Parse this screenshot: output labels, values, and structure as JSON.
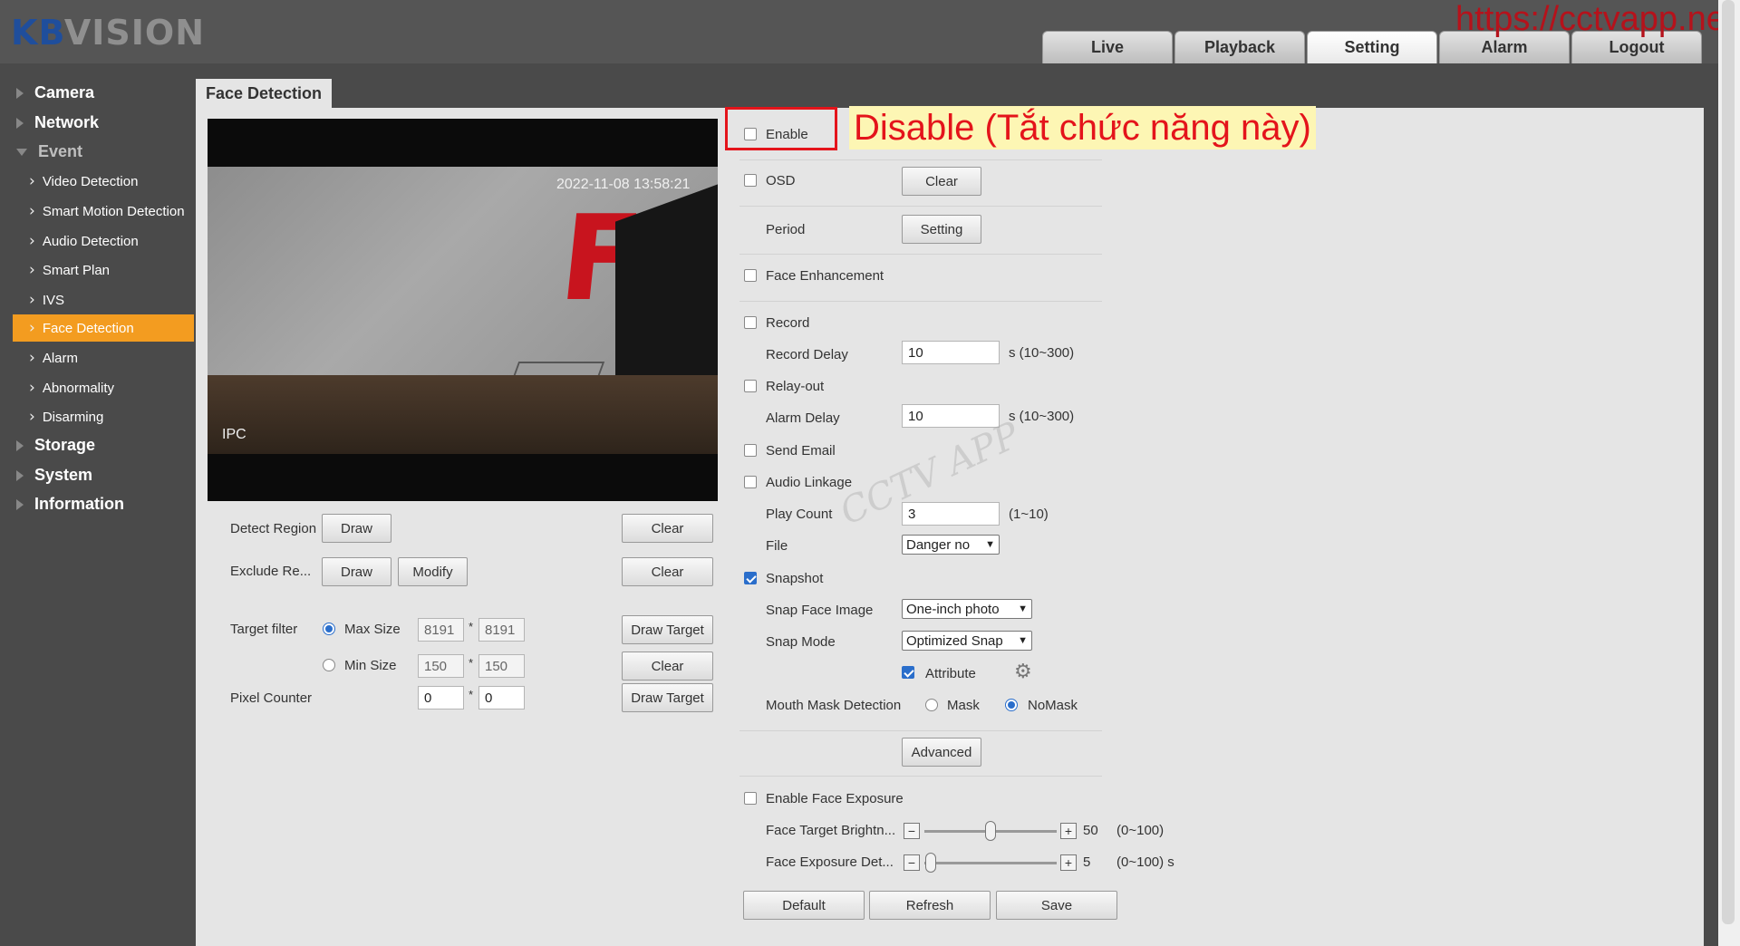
{
  "header": {
    "logo_kb": "KB",
    "logo_vision": "VISION",
    "watermark_url": "https://cctvapp.net",
    "nav": [
      "Live",
      "Playback",
      "Setting",
      "Alarm",
      "Logout"
    ]
  },
  "sidebar": {
    "camera": "Camera",
    "network": "Network",
    "event": "Event",
    "sub": [
      "Video Detection",
      "Smart Motion Detection",
      "Audio Detection",
      "Smart Plan",
      "IVS",
      "Face Detection",
      "Alarm",
      "Abnormality",
      "Disarming"
    ],
    "storage": "Storage",
    "system": "System",
    "information": "Information"
  },
  "page": {
    "tab": "Face Detection"
  },
  "video": {
    "timestamp": "2022-11-08 13:58:21",
    "channel": "IPC"
  },
  "left": {
    "detect_region": "Detect Region",
    "exclude_region": "Exclude Re...",
    "draw": "Draw",
    "modify": "Modify",
    "clear": "Clear",
    "target_filter": "Target filter",
    "max_size": "Max Size",
    "min_size": "Min Size",
    "max_w": "8191",
    "max_h": "8191",
    "min_w": "150",
    "min_h": "150",
    "pixel_counter": "Pixel Counter",
    "pc_w": "0",
    "pc_h": "0",
    "times": "*",
    "draw_target": "Draw Target"
  },
  "right": {
    "enable": "Enable",
    "osd": "OSD",
    "osd_clear": "Clear",
    "period": "Period",
    "period_setting": "Setting",
    "face_enhancement": "Face Enhancement",
    "record": "Record",
    "record_delay": "Record Delay",
    "record_delay_value": "10",
    "record_delay_range": "s (10~300)",
    "relay_out": "Relay-out",
    "alarm_delay": "Alarm Delay",
    "alarm_delay_value": "10",
    "alarm_delay_range": "s (10~300)",
    "send_email": "Send Email",
    "audio_linkage": "Audio Linkage",
    "play_count": "Play Count",
    "play_count_value": "3",
    "play_count_range": "(1~10)",
    "file": "File",
    "file_value": "Danger no",
    "snapshot": "Snapshot",
    "snap_face_image": "Snap Face Image",
    "snap_face_image_value": "One-inch photo",
    "snap_mode": "Snap Mode",
    "snap_mode_value": "Optimized Snap",
    "attribute": "Attribute",
    "mouth_mask": "Mouth Mask Detection",
    "mask": "Mask",
    "nomask": "NoMask",
    "advanced": "Advanced",
    "enable_face_exposure": "Enable Face Exposure",
    "face_target_brightness": "Face Target Brightn...",
    "brightness_value": 50,
    "brightness_range": "(0~100)",
    "face_exposure_detect": "Face Exposure Det...",
    "exposure_value": 5,
    "exposure_range": "(0~100) s",
    "default": "Default",
    "refresh": "Refresh",
    "save": "Save"
  },
  "annotation": {
    "text": "Disable (Tắt chức năng này)",
    "watermark": "CCTV APP"
  },
  "state": {
    "enable": false,
    "osd": false,
    "face_enhancement": false,
    "record": false,
    "relay_out": false,
    "send_email": false,
    "audio_linkage": false,
    "snapshot": true,
    "attribute": true,
    "enable_face_exposure": false,
    "target_filter": "max",
    "mouth_mask": "nomask"
  },
  "colors": {
    "accent": "#f39c20",
    "annotation": "#e4141b",
    "check": "#2a6ecb"
  }
}
